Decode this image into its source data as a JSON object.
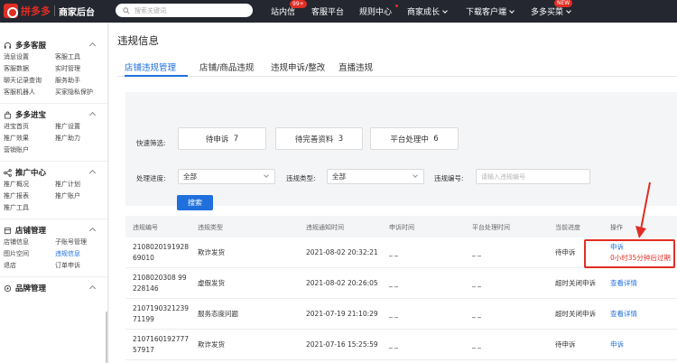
{
  "topbar": {
    "logo_text": "拼多多",
    "logo_sub": "商家后台",
    "search_placeholder": "搜索关键词",
    "nav": [
      {
        "label": "站内信",
        "badge": "99+"
      },
      {
        "label": "客服平台"
      },
      {
        "label": "规则中心"
      },
      {
        "label": "商家成长"
      },
      {
        "label": "下载客户端"
      },
      {
        "label": "多多买菜",
        "badge": "NEW"
      }
    ]
  },
  "sidebar": {
    "sections": [
      {
        "title": "多多客服",
        "icon": "headset-icon",
        "items": [
          "消息设置",
          "客服工具",
          "客服数据",
          "实时管理",
          "聊天记录查询",
          "服务助手",
          "客服机器人",
          "买家隐私保护"
        ]
      },
      {
        "title": "多多进宝",
        "icon": "bag-icon",
        "items": [
          "进宝首页",
          "推广设置",
          "推广效果",
          "推广助力",
          "营销账户"
        ]
      },
      {
        "title": "推广中心",
        "icon": "share-icon",
        "items": [
          "推广概况",
          "推广计划",
          "推广报表",
          "推广账户",
          "推广工具"
        ]
      },
      {
        "title": "店铺管理",
        "icon": "store-icon",
        "items": [
          "店铺信息",
          "子账号管理",
          "图片空间",
          "违规信息",
          "退店",
          "订单申诉"
        ],
        "active": "违规信息"
      },
      {
        "title": "品牌管理",
        "icon": "brand-icon",
        "items": []
      }
    ]
  },
  "main": {
    "title": "违规信息",
    "tabs": [
      "店铺违规管理",
      "店铺/商品违规",
      "违规申诉/整改",
      "直播违规"
    ],
    "quick_filter_label": "快速筛选:",
    "quick_filters": [
      {
        "label": "待申诉",
        "count": "7"
      },
      {
        "label": "待完善资料",
        "count": "3"
      },
      {
        "label": "平台处理中",
        "count": "6"
      }
    ],
    "filters": {
      "progress_label": "处理进度:",
      "progress_value": "全部",
      "type_label": "违规类型:",
      "type_value": "全部",
      "id_label": "违规编号:",
      "id_placeholder": "请输入违规编号"
    },
    "search_button": "搜索",
    "table": {
      "headers": [
        "违规编号",
        "违规类型",
        "违规通知时间",
        "申诉时间",
        "平台处理时间",
        "当前进度",
        "操作"
      ],
      "rows": [
        {
          "id_line1": "2108020191928",
          "id_line2": "69010",
          "type": "欺诈发货",
          "notice_time": "2021-08-02 20:32:21",
          "appeal_time": "_ _",
          "platform_time": "_ _",
          "progress": "待申诉",
          "action1": "申诉",
          "action2": "0小时35分钟后过期"
        },
        {
          "id_line1": "2108020308 99",
          "id_line2": "228146",
          "type": "虚假发货",
          "notice_time": "2021-08-02 20:26:05",
          "appeal_time": "_ _",
          "platform_time": "_ _",
          "progress": "超时关闭申诉",
          "action1": "查看详情",
          "action2": ""
        },
        {
          "id_line1": "2107190321239",
          "id_line2": "71199",
          "type": "服务态度问题",
          "notice_time": "2021-07-19 21:10:29",
          "appeal_time": "_ _",
          "platform_time": "_ _",
          "progress": "超时关闭申诉",
          "action1": "查看详情",
          "action2": ""
        },
        {
          "id_line1": "2107160192777",
          "id_line2": "57917",
          "type": "欺诈发货",
          "notice_time": "2021-07-16 15:25:59",
          "appeal_time": "_ _",
          "platform_time": "_ _",
          "progress": "待申诉",
          "action1": "申诉",
          "action2": ""
        }
      ]
    }
  },
  "colors": {
    "accent": "#1f6fdc",
    "brand": "#e02e24",
    "topbar": "#242730"
  }
}
